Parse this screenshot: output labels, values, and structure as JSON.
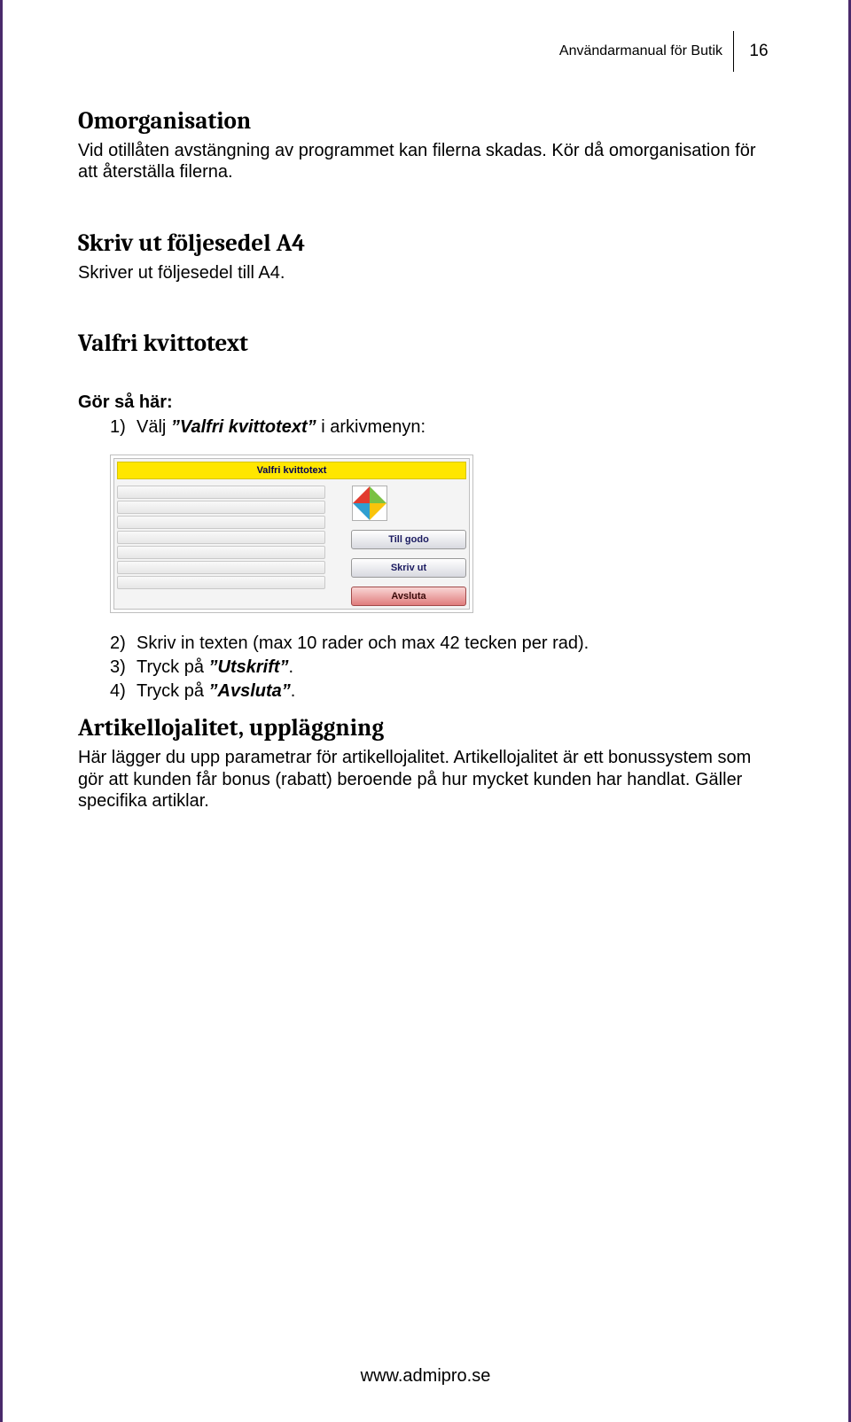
{
  "header": {
    "doc_title": "Användarmanual för Butik",
    "page_number": "16"
  },
  "sec1": {
    "heading": "Omorganisation",
    "p": "Vid otillåten avstängning av programmet kan filerna skadas. Kör då omorganisation för att återställa filerna."
  },
  "sec2": {
    "heading": "Skriv ut följesedel A4",
    "p": "Skriver ut följesedel till A4."
  },
  "sec3": {
    "heading": "Valfri kvittotext",
    "lead": "Gör så här:",
    "step1_pre": "Välj ",
    "step1_bold": "”Valfri kvittotext”",
    "step1_post": " i arkivmenyn:",
    "panel": {
      "title": "Valfri kvittotext",
      "btn1": "Till godo",
      "btn2": "Skriv ut",
      "btn3": "Avsluta"
    },
    "step2": "Skriv in texten (max 10 rader och max 42 tecken per rad).",
    "step3_pre": "Tryck på ",
    "step3_bold": "”Utskrift”",
    "step3_post": ".",
    "step4_pre": "Tryck på ",
    "step4_bold": "”Avsluta”",
    "step4_post": "."
  },
  "sec4": {
    "heading": "Artikellojalitet, uppläggning",
    "p": "Här lägger du upp parametrar för artikellojalitet. Artikellojalitet är ett bonussystem som gör att kunden får bonus (rabatt) beroende på hur mycket kunden har handlat. Gäller specifika artiklar."
  },
  "footer": {
    "url": "www.admipro.se"
  }
}
